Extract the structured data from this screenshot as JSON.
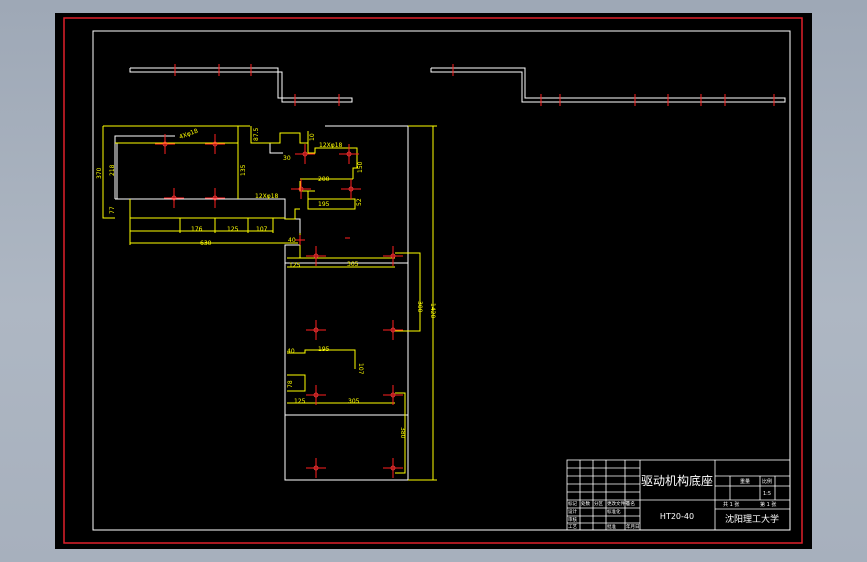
{
  "drawing": {
    "title": "驱动机构底座",
    "code": "HT20-40",
    "school": "沈阳理工大学",
    "title_block": {
      "scale_label": "比例",
      "scale_value": "1:5",
      "sheet_label": "第 1 张",
      "total_label": "共 1 张",
      "weight_label": "重量",
      "rows": [
        {
          "a": "标记",
          "b": "处数",
          "c": "分区",
          "d": "更改文件号",
          "e": "签名",
          "f": "年月日"
        },
        {
          "a": "设计",
          "b": "",
          "c": "",
          "d": "标准化",
          "e": "",
          "f": ""
        },
        {
          "a": "审核",
          "b": "",
          "c": "",
          "d": "",
          "e": "",
          "f": ""
        },
        {
          "a": "工艺",
          "b": "",
          "c": "",
          "d": "批准",
          "e": "",
          "f": ""
        }
      ]
    },
    "dimensions": {
      "hole_spec_1": "4Xφ18",
      "hole_spec_2": "12Xφ18",
      "hole_spec_3": "12Xφ18",
      "d_370": "370",
      "d_218": "218",
      "d_77": "77",
      "d_176": "176",
      "d_125a": "125",
      "d_107a": "107",
      "d_630": "630",
      "d_87_5": "87.5",
      "d_135a": "135",
      "d_30": "30",
      "d_10": "10",
      "d_200": "200",
      "d_150": "150",
      "d_195a": "195",
      "d_52": "52",
      "d_40a": "40",
      "d_125b": "125",
      "d_305a": "305",
      "d_300": "300",
      "d_1420": "1420",
      "d_40b": "40",
      "d_195b": "195",
      "d_107b": "107",
      "d_78": "78",
      "d_125c": "125",
      "d_305b": "305",
      "d_380": "380"
    }
  }
}
